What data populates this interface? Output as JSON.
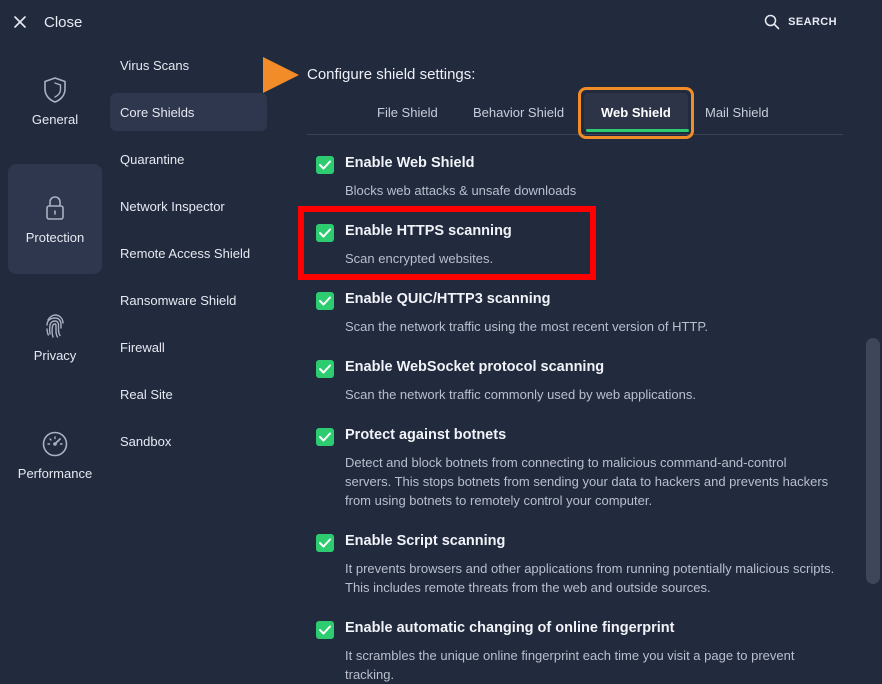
{
  "header": {
    "close_label": "Close",
    "search_label": "SEARCH"
  },
  "left_nav": [
    {
      "label": "General",
      "icon": "shield-icon"
    },
    {
      "label": "Protection",
      "icon": "lock-icon",
      "active": true
    },
    {
      "label": "Privacy",
      "icon": "fingerprint-icon"
    },
    {
      "label": "Performance",
      "icon": "speedometer-icon"
    }
  ],
  "sub_nav": [
    {
      "label": "Virus Scans"
    },
    {
      "label": "Core Shields",
      "active": true
    },
    {
      "label": "Quarantine"
    },
    {
      "label": "Network Inspector"
    },
    {
      "label": "Remote Access Shield"
    },
    {
      "label": "Ransomware Shield"
    },
    {
      "label": "Firewall"
    },
    {
      "label": "Real Site"
    },
    {
      "label": "Sandbox"
    }
  ],
  "main": {
    "title": "Configure shield settings:",
    "tabs": [
      {
        "label": "File Shield"
      },
      {
        "label": "Behavior Shield"
      },
      {
        "label": "Web Shield",
        "active": true
      },
      {
        "label": "Mail Shield"
      }
    ],
    "settings": [
      {
        "title": "Enable Web Shield",
        "desc": "Blocks web attacks & unsafe downloads",
        "checked": true
      },
      {
        "title": "Enable HTTPS scanning",
        "desc": "Scan encrypted websites.",
        "checked": true
      },
      {
        "title": "Enable QUIC/HTTP3 scanning",
        "desc": "Scan the network traffic using the most recent version of HTTP.",
        "checked": true
      },
      {
        "title": "Enable WebSocket protocol scanning",
        "desc": "Scan the network traffic commonly used by web applications.",
        "checked": true
      },
      {
        "title": "Protect against botnets",
        "desc": "Detect and block botnets from connecting to malicious command-and-control servers. This stops botnets from sending your data to hackers and prevents hackers from using botnets to remotely control your computer.",
        "checked": true
      },
      {
        "title": "Enable Script scanning",
        "desc": "It prevents browsers and other applications from running potentially malicious scripts. This includes remote threats from the web and outside sources.",
        "checked": true
      },
      {
        "title": "Enable automatic changing of online fingerprint",
        "desc": "It scrambles the unique online fingerprint each time you visit a page to prevent tracking.",
        "checked": true
      }
    ]
  },
  "colors": {
    "background": "#222a3e",
    "active_item": "#2e374d",
    "check_green": "#2ecc71",
    "annotation_orange": "#f28c28",
    "annotation_red": "#ff0000"
  }
}
